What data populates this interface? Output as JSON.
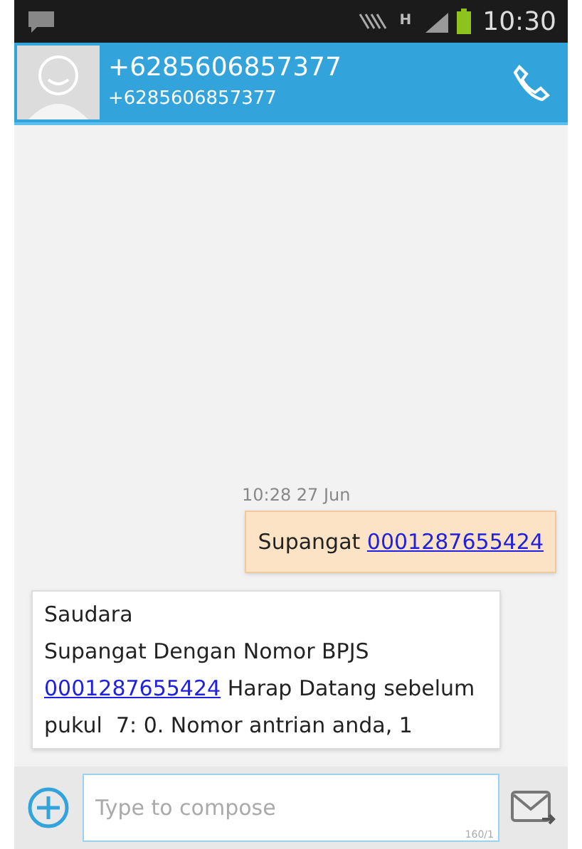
{
  "status_bar": {
    "time": "10:30",
    "network": "H"
  },
  "header": {
    "name": "+6285606857377",
    "number": "+6285606857377"
  },
  "messages": [
    {
      "kind": "sent",
      "timestamp": "10:28 27 Jun",
      "parts": [
        {
          "kind": "text",
          "text": "Supangat "
        },
        {
          "kind": "link",
          "text": "0001287655424"
        }
      ]
    },
    {
      "kind": "received",
      "parts": [
        {
          "kind": "text",
          "text": "Saudara\nSupangat Dengan Nomor BPJS\n"
        },
        {
          "kind": "link",
          "text": "0001287655424"
        },
        {
          "kind": "text",
          "text": " Harap Datang sebelum pukul  7: 0. Nomor antrian anda, 1"
        }
      ]
    }
  ],
  "composer": {
    "placeholder": "Type to compose",
    "counter": "160/1"
  }
}
